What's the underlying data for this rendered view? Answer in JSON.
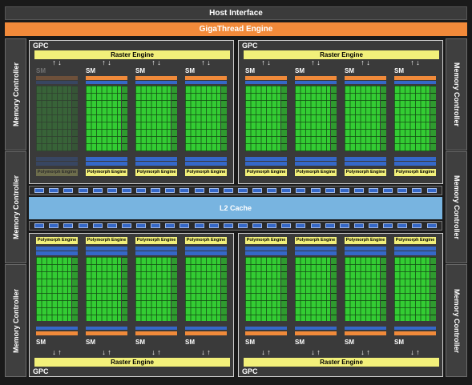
{
  "host_interface": "Host Interface",
  "gigathread": "GigaThread Engine",
  "memory_controller": "Memory Controller",
  "gpc_label": "GPC",
  "raster_engine": "Raster Engine",
  "sm_label": "SM",
  "polymorph_engine": "Polymorph Engine",
  "l2_cache": "L2 Cache",
  "colors": {
    "chip_background": "#1a1a1a",
    "gigathread_orange": "#f28a3a",
    "raster_yellow": "#f2f07a",
    "cuda_core_green": "#33cc33",
    "register_blue": "#3568c8",
    "l2_blue": "#78b4e0"
  },
  "disabled_sm": {
    "gpc": "top-left",
    "sm_index": 1
  }
}
